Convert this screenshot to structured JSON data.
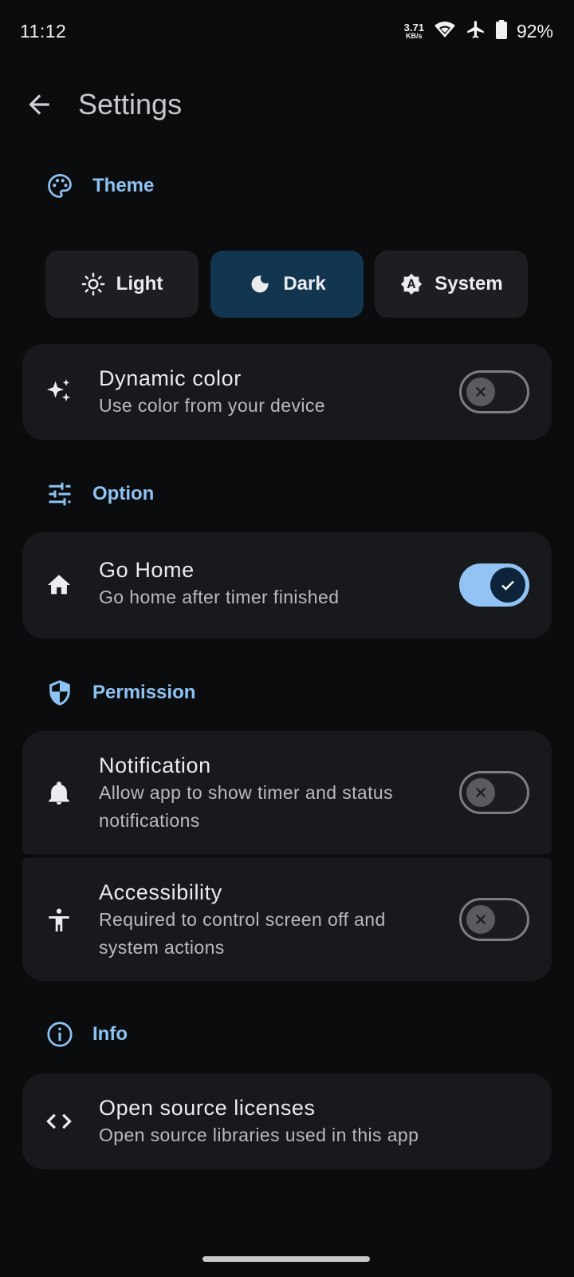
{
  "status_bar": {
    "time": "11:12",
    "net_speed_value": "3.71",
    "net_speed_unit": "KB/s",
    "battery": "92%",
    "icons": [
      "wifi-icon",
      "airplane-icon",
      "battery-icon"
    ]
  },
  "header": {
    "title": "Settings"
  },
  "sections": {
    "theme": {
      "label": "Theme",
      "options": [
        {
          "label": "Light",
          "icon": "sun-icon",
          "selected": false
        },
        {
          "label": "Dark",
          "icon": "moon-icon",
          "selected": true
        },
        {
          "label": "System",
          "icon": "auto-theme-icon",
          "selected": false
        }
      ],
      "dynamic_color": {
        "title": "Dynamic color",
        "subtitle": "Use color from your device",
        "enabled": false
      }
    },
    "option": {
      "label": "Option",
      "go_home": {
        "title": "Go Home",
        "subtitle": "Go home after timer finished",
        "enabled": true
      }
    },
    "permission": {
      "label": "Permission",
      "notification": {
        "title": "Notification",
        "subtitle": "Allow app to show timer and status notifications",
        "enabled": false
      },
      "accessibility": {
        "title": "Accessibility",
        "subtitle": "Required to control screen off and system actions",
        "enabled": false
      }
    },
    "info": {
      "label": "Info",
      "licenses": {
        "title": "Open source licenses",
        "subtitle": "Open source libraries used in this app"
      }
    }
  },
  "colors": {
    "background": "#0b0c0e",
    "card": "#18191c",
    "accent": "#8ec3f3",
    "selected_theme": "#133650"
  }
}
